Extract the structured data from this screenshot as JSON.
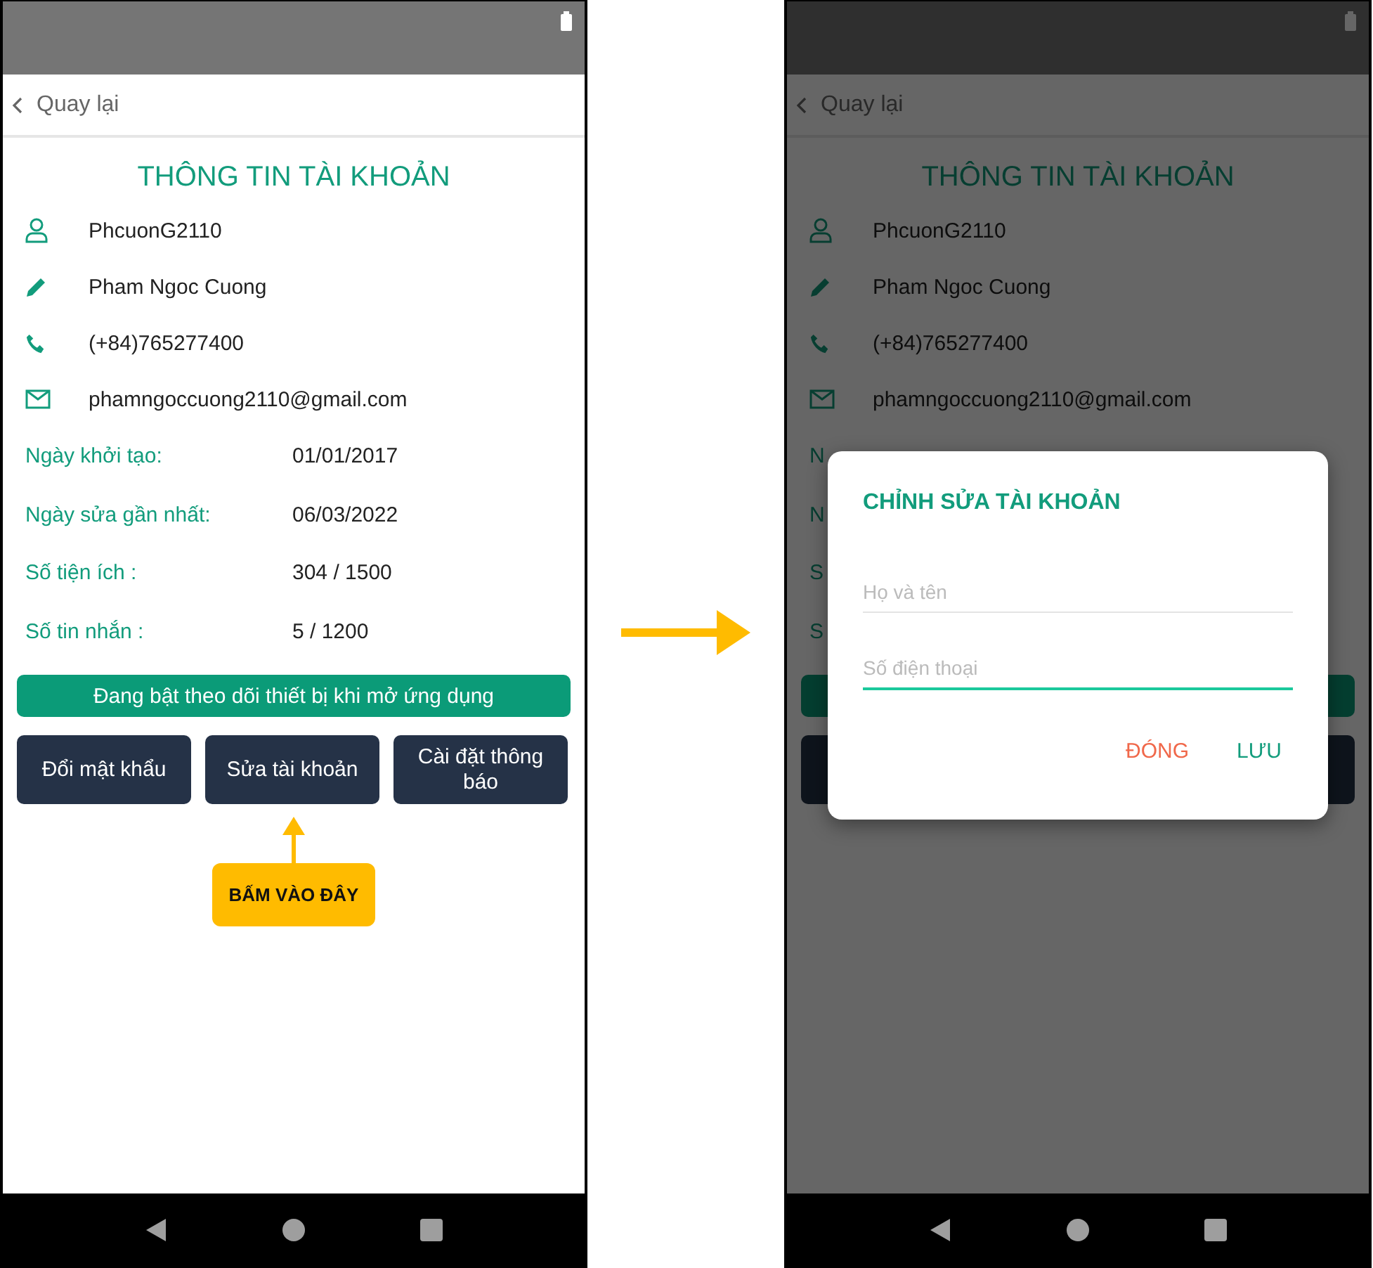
{
  "screens": [
    {
      "dimmed": false,
      "back": "Quay lại",
      "title": "THÔNG TIN TÀI KHOẢN",
      "info": [
        "PhcuonG2110",
        "Pham Ngoc Cuong",
        "(+84)765277400",
        "phamngoccuong2110@gmail.com"
      ],
      "stats": [
        {
          "label": "Ngày khởi tạo:",
          "value": "01/01/2017"
        },
        {
          "label": "Ngày sửa gần nhất:",
          "value": "06/03/2022"
        },
        {
          "label": "Số tiện ích :",
          "value": "304 / 1500"
        },
        {
          "label": "Số tin nhắn :",
          "value": "5 / 1200"
        }
      ],
      "banner": "Đang bật theo dõi thiết bị khi mở ứng dụng",
      "buttons": [
        "Đổi mật khẩu",
        "Sửa tài khoản",
        "Cài đặt thông báo"
      ],
      "callout": "BẤM VÀO ĐÂY"
    },
    {
      "dimmed": true,
      "back": "Quay lại",
      "title": "THÔNG TIN TÀI KHOẢN",
      "info": [
        "PhcuonG2110",
        "Pham Ngoc Cuong",
        "(+84)765277400",
        "phamngoccuong2110@gmail.com"
      ],
      "stats": [
        {
          "label": "N"
        },
        {
          "label": "N"
        },
        {
          "label": "S"
        },
        {
          "label": "S"
        }
      ],
      "covered_controls": true,
      "dialog": {
        "title": "CHỈNH SỬA TÀI KHOẢN",
        "fields": [
          {
            "placeholder": "Họ và tên",
            "focused": false
          },
          {
            "placeholder": "Số điện thoại",
            "focused": true
          }
        ],
        "actions": [
          {
            "label": "ĐÓNG",
            "kind": "cancel"
          },
          {
            "label": "LƯU",
            "kind": "confirm"
          }
        ]
      }
    }
  ]
}
